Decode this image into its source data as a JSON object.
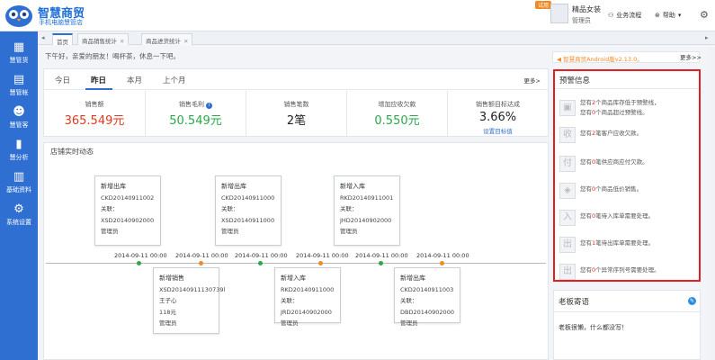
{
  "brand": {
    "title": "智慧商贸",
    "subtitle": "手机电脑慧管店"
  },
  "user": {
    "badge": "试用",
    "name": "精品女装",
    "role": "管理员"
  },
  "header_links": {
    "workflow": "业务流程",
    "help": "帮助"
  },
  "sidebar": [
    {
      "label": "慧管货",
      "icon": "box-icon"
    },
    {
      "label": "慧管帐",
      "icon": "ledger-icon"
    },
    {
      "label": "慧管客",
      "icon": "users-icon"
    },
    {
      "label": "慧分析",
      "icon": "chart-icon"
    },
    {
      "label": "基础资料",
      "icon": "book-icon"
    },
    {
      "label": "系统设置",
      "icon": "gear-icon"
    }
  ],
  "tabs": [
    {
      "label": "首页"
    },
    {
      "label": "商品销售统计"
    },
    {
      "label": "商品进货统计"
    }
  ],
  "greeting": "下午好，亲爱的朋友！喝杯茶，休息一下吧。",
  "notice": {
    "text": "智慧商贸Android版v2.13.0。",
    "more": "更多>>"
  },
  "stats": {
    "periods": [
      "今日",
      "昨日",
      "本月",
      "上个月"
    ],
    "more": "更多>",
    "cells": [
      {
        "label": "销售额",
        "value": "365.549元",
        "color": "#e03a1e"
      },
      {
        "label": "销售毛利",
        "value": "50.549元",
        "color": "#2aa84a"
      },
      {
        "label": "销售笔数",
        "value": "2笔",
        "color": "#222222"
      },
      {
        "label": "增加应收欠款",
        "value": "0.550元",
        "color": "#2aa84a"
      },
      {
        "label": "销售额目标达成",
        "value": "3.66%",
        "color": "#222222",
        "link": "设置目标值"
      }
    ]
  },
  "timeline": {
    "title": "店铺实时动态",
    "top_cards": [
      {
        "title": "新增出库",
        "code": "CKD20140911002",
        "relation": "关联：XSD20140902000",
        "role": "管理员"
      },
      {
        "title": "新增出库",
        "code": "CKD20140911000",
        "relation": "关联：XSD20140911000",
        "role": "管理员"
      },
      {
        "title": "新增入库",
        "code": "RKD20140911001",
        "relation": "关联：JHD20140902000",
        "role": "管理员"
      }
    ],
    "bottom_cards": [
      {
        "title": "新增销售",
        "code": "XSD20140911130739l",
        "customer": "王子心",
        "amount": "118元",
        "role": "管理员"
      },
      {
        "title": "新增入库",
        "code": "RKD20140911000",
        "relation": "关联：JRD20140902000",
        "role": "管理员"
      },
      {
        "title": "新增出库",
        "code": "CKD20140911003",
        "relation": "关联：DBD20140902000",
        "role": "管理员"
      }
    ],
    "dates": [
      "2014-09-11 00:00",
      "2014-09-11 00:00",
      "2014-09-11 00:00",
      "2014-09-11 00:00",
      "2014-09-11 00:00",
      "2014-09-11 00:00"
    ]
  },
  "alerts": {
    "title": "预警信息",
    "items": [
      {
        "icon": "box",
        "lines": [
          {
            "pre": "您有",
            "n": "2",
            "post": "个商品库存低于预警线，"
          },
          {
            "pre": "您有",
            "n": "0",
            "post": "个商品超过预警线。"
          }
        ]
      },
      {
        "icon": "收",
        "lines": [
          {
            "pre": "您有",
            "n": "2",
            "post": "笔客户应收欠款。"
          }
        ]
      },
      {
        "icon": "付",
        "lines": [
          {
            "pre": "您有",
            "n": "0",
            "post": "笔供应商应付欠款。"
          }
        ]
      },
      {
        "icon": "tag",
        "lines": [
          {
            "pre": "您有",
            "n": "0",
            "post": "个商品低价销售。"
          }
        ]
      },
      {
        "icon": "入",
        "lines": [
          {
            "pre": "您有",
            "n": "0",
            "post": "笔待入库单需要处理。"
          }
        ]
      },
      {
        "icon": "出",
        "lines": [
          {
            "pre": "您有",
            "n": "1",
            "post": "笔待出库单需要处理。"
          }
        ]
      },
      {
        "icon": "出",
        "lines": [
          {
            "pre": "您有",
            "n": "0",
            "post": "个异常序列号需要处理。"
          }
        ]
      }
    ]
  },
  "boss": {
    "title": "老板寄语",
    "message": "老板很懒，什么都没写！"
  },
  "colors": {
    "primary": "#2f6fd1",
    "accent": "#f08a24",
    "alert": "#e02020",
    "positive": "#2aa84a"
  }
}
